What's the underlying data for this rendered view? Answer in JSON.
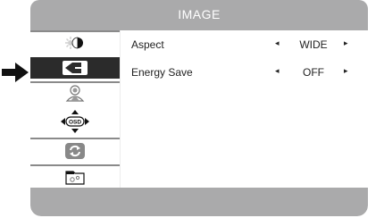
{
  "menu": {
    "title": "IMAGE"
  },
  "sidebar": {
    "items": [
      {
        "icon": "brightness-contrast-icon"
      },
      {
        "icon": "image-icon",
        "selected": true
      },
      {
        "icon": "color-icon"
      },
      {
        "icon": "osd-icon",
        "text": "OSD"
      },
      {
        "icon": "reset-icon"
      },
      {
        "icon": "setup-icon"
      }
    ]
  },
  "settings": [
    {
      "label": "Aspect",
      "value": "WIDE"
    },
    {
      "label": "Energy Save",
      "value": "OFF"
    }
  ],
  "arrows": {
    "left": "◂",
    "right": "▸"
  },
  "colors": {
    "title_bar": "#aaaaab",
    "selected_item": "#2b2b2b",
    "text": "#222222"
  }
}
